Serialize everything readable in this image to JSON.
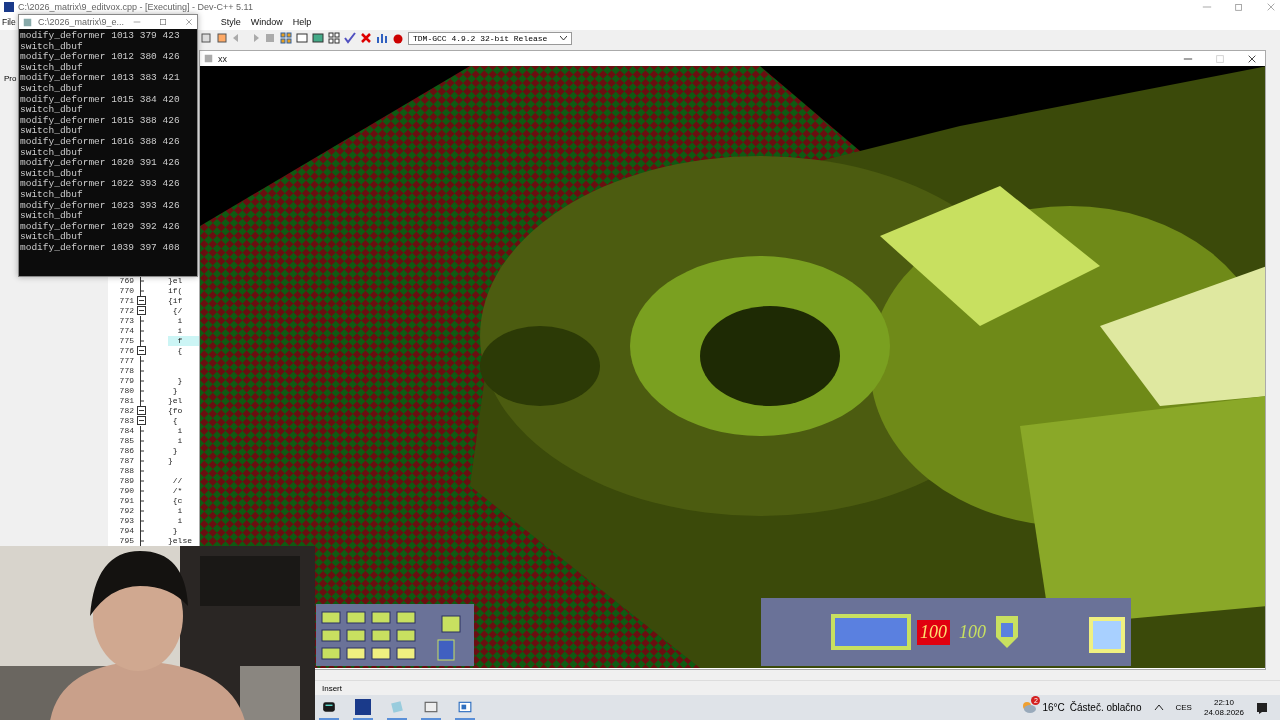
{
  "ide": {
    "title": "C:\\2026_matrix\\9_editvox.cpp - [Executing] - Dev-C++ 5.11",
    "menu": [
      "File",
      "Style",
      "Window",
      "Help"
    ],
    "compiler": "TDM-GCC 4.9.2 32-bit Release",
    "panel_tab": "Pro",
    "editor": {
      "lines": [
        {
          "number": "769",
          "code": "}el",
          "fold_toggle": false,
          "highlighted": false
        },
        {
          "number": "770",
          "code": "if(",
          "fold_toggle": false,
          "highlighted": false
        },
        {
          "number": "771",
          "code": "{if",
          "fold_toggle": true,
          "highlighted": false
        },
        {
          "number": "772",
          "code": " {/",
          "fold_toggle": true,
          "highlighted": false
        },
        {
          "number": "773",
          "code": "  i",
          "fold_toggle": false,
          "highlighted": false
        },
        {
          "number": "774",
          "code": "  i",
          "fold_toggle": false,
          "highlighted": false
        },
        {
          "number": "775",
          "code": "  f",
          "fold_toggle": false,
          "highlighted": true
        },
        {
          "number": "776",
          "code": "  {",
          "fold_toggle": true,
          "highlighted": false
        },
        {
          "number": "777",
          "fold_toggle": false,
          "highlighted": false
        },
        {
          "number": "778",
          "fold_toggle": false,
          "highlighted": false
        },
        {
          "number": "779",
          "code": "  }",
          "fold_toggle": false,
          "highlighted": false
        },
        {
          "number": "780",
          "code": " }",
          "fold_toggle": false,
          "highlighted": false
        },
        {
          "number": "781",
          "code": "}el",
          "fold_toggle": false,
          "highlighted": false
        },
        {
          "number": "782",
          "code": "{fo",
          "fold_toggle": true,
          "highlighted": false
        },
        {
          "number": "783",
          "code": " {",
          "fold_toggle": true,
          "highlighted": false
        },
        {
          "number": "784",
          "code": "  i",
          "fold_toggle": false,
          "highlighted": false
        },
        {
          "number": "785",
          "code": "  i",
          "fold_toggle": false,
          "highlighted": false
        },
        {
          "number": "786",
          "code": " }",
          "fold_toggle": false,
          "highlighted": false
        },
        {
          "number": "787",
          "code": "}",
          "fold_toggle": false,
          "highlighted": false
        },
        {
          "number": "788",
          "fold_toggle": false,
          "highlighted": false
        },
        {
          "number": "789",
          "code": " //",
          "fold_toggle": false,
          "highlighted": false
        },
        {
          "number": "790",
          "code": " /*",
          "fold_toggle": false,
          "highlighted": false
        },
        {
          "number": "791",
          "code": " {c",
          "fold_toggle": false,
          "highlighted": false
        },
        {
          "number": "792",
          "code": "  i",
          "fold_toggle": false,
          "highlighted": false
        },
        {
          "number": "793",
          "code": "  i",
          "fold_toggle": false,
          "highlighted": false
        },
        {
          "number": "794",
          "code": " }",
          "fold_toggle": false,
          "highlighted": false
        },
        {
          "number": "795",
          "code": "}else",
          "fold_toggle": false,
          "highlighted": false
        }
      ]
    },
    "status": "Insert"
  },
  "console": {
    "title": "C:\\2026_matrix\\9_e...",
    "lines": [
      "modify_deformer 1013 379 423",
      "switch_dbuf",
      "modify_deformer 1012 380 426",
      "switch_dbuf",
      "modify_deformer 1013 383 421",
      "switch_dbuf",
      "modify_deformer 1015 384 420",
      "switch_dbuf",
      "modify_deformer 1015 388 426",
      "switch_dbuf",
      "modify_deformer 1016 388 426",
      "switch_dbuf",
      "modify_deformer 1020 391 426",
      "switch_dbuf",
      "modify_deformer 1022 393 426",
      "switch_dbuf",
      "modify_deformer 1023 393 426",
      "switch_dbuf",
      "modify_deformer 1029 392 426",
      "switch_dbuf",
      "modify_deformer 1039 397 408"
    ]
  },
  "game": {
    "title": "xx",
    "hud": {
      "health": "100",
      "armor": "100"
    }
  },
  "taskbar": {
    "weather": {
      "badge": "2",
      "temperature": "16°C",
      "condition": "Částeč. oblačno"
    },
    "language": "CES",
    "time": "22:10",
    "date": "24.08.2026"
  }
}
